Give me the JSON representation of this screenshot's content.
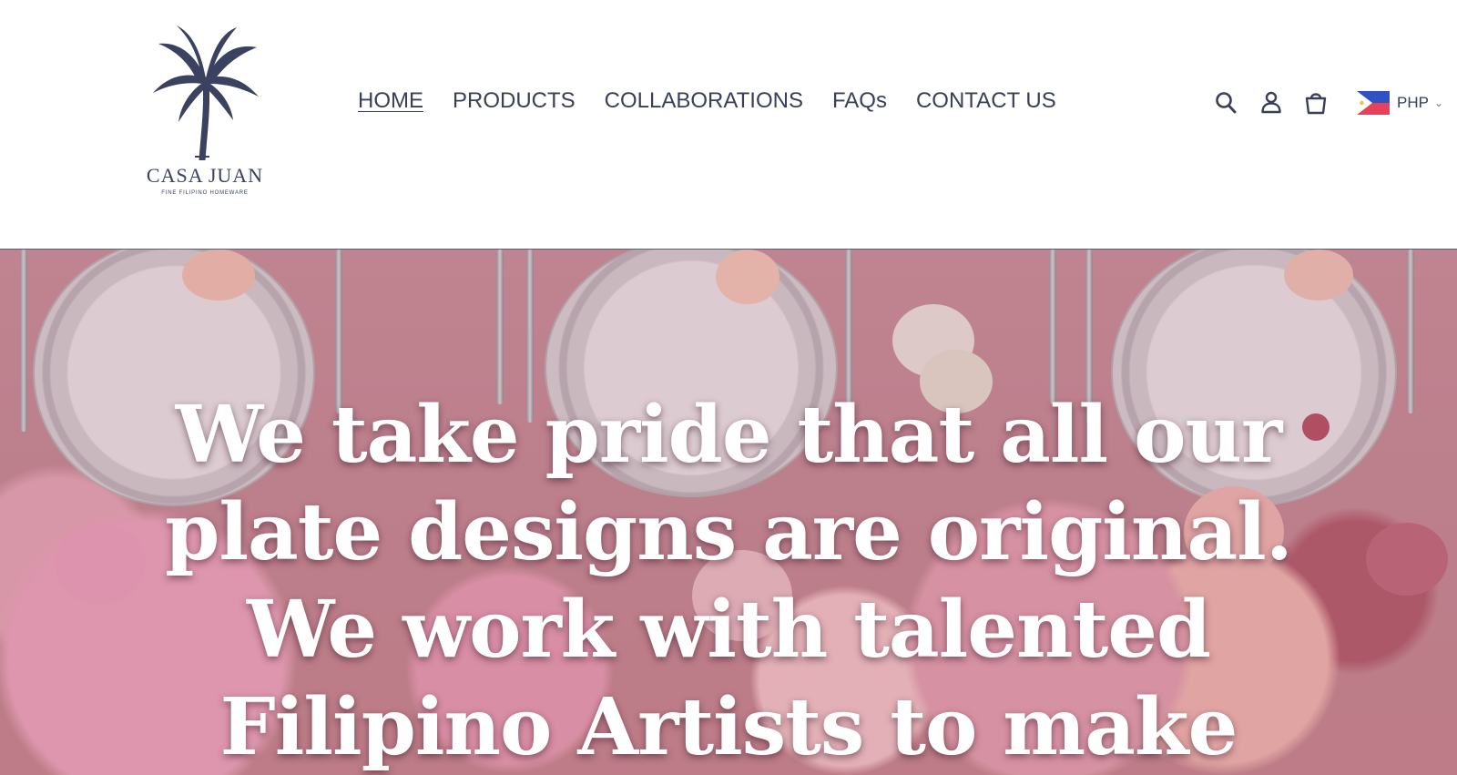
{
  "brand": {
    "name": "CASA JUAN",
    "tagline": "FINE FILIPINO HOMEWARE"
  },
  "nav": {
    "items": [
      {
        "label": "HOME",
        "active": true
      },
      {
        "label": "PRODUCTS",
        "active": false
      },
      {
        "label": "COLLABORATIONS",
        "active": false
      },
      {
        "label": "FAQs",
        "active": false
      },
      {
        "label": "CONTACT US",
        "active": false
      }
    ]
  },
  "header_icons": {
    "search": "search-icon",
    "account": "account-icon",
    "cart": "cart-icon"
  },
  "currency": {
    "code": "PHP",
    "flag": "philippines-flag-icon"
  },
  "hero": {
    "lines": [
      "We take pride that all our",
      "plate designs are original.",
      "We work with talented",
      "Filipino Artists to make"
    ]
  },
  "colors": {
    "brand_navy": "#3a4260",
    "text": "#3a3f58",
    "hero_bg": "#c58a95"
  }
}
